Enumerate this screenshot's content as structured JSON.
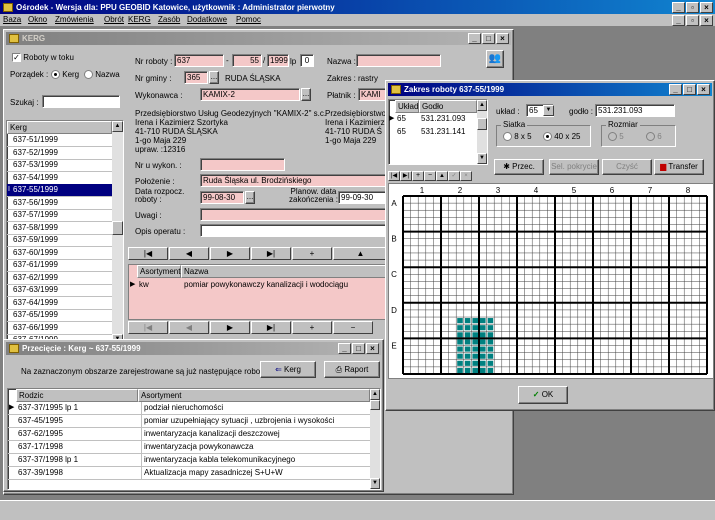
{
  "app": {
    "title": "Ośrodek - Wersja dla: PPU GEOBID Katowice, użytkownik : Administrator pierwotny",
    "menu": [
      "Baza",
      "Okno",
      "Zmówienia",
      "Obrót",
      "KERG",
      "Zasób",
      "Dodatkowe",
      "Pomoc"
    ]
  },
  "kerg": {
    "title": "KERG",
    "roboty_w_toku": "Roboty w toku",
    "porzadek_label": "Porządek :",
    "porzadek_kerg": "Kerg",
    "porzadek_nazwa": "Nazwa",
    "szukaj_label": "Szukaj :",
    "szukaj_value": "",
    "list_header": "Kerg",
    "list": [
      "637-51/1999",
      "637-52/1999",
      "637-53/1999",
      "637-54/1999",
      "637-55/1999",
      "637-56/1999",
      "637-57/1999",
      "637-58/1999",
      "637-59/1999",
      "637-60/1999",
      "637-61/1999",
      "637-62/1999",
      "637-63/1999",
      "637-64/1999",
      "637-65/1999",
      "637-66/1999",
      "637-67/1999"
    ],
    "selected_index": 4,
    "nr_roboty_label": "Nr roboty :",
    "nr1": "637",
    "nr2": "55",
    "nr3": "1999",
    "lp_label": "lp",
    "lp_value": "0",
    "nazwa_label": "Nazwa :",
    "nazwa_value": "",
    "nr_gminy_label": "Nr gminy :",
    "nr_gminy_value": "365",
    "gmina_name": "RUDA ŚLĄSKA",
    "zakres_label": "Zakres :",
    "zakres_value": "rastry",
    "wykonawca_label": "Wykonawca :",
    "wykonawca_value": "KAMIX-2",
    "platnik_label": "Płatnik :",
    "platnik_value": "KAMI",
    "wykonawca_address": [
      "Przedsiębiorstwo Usług Geodezyjnych \"KAMIX-2\" s.c.",
      "Irena i Kazimierz Szortyka",
      "41-710 RUDA ŚLĄSKA",
      "1-go Maja 229",
      "upraw. :12316"
    ],
    "platnik_address": [
      "Przedsiębiorstwo",
      "Irena i Kazimierz",
      "41-710 RUDA Ś",
      "1-go Maja 229"
    ],
    "nr_u_wykon_label": "Nr u wykon. :",
    "polozenie_label": "Położenie :",
    "polozenie_value": "Ruda Śląska ul. Brodzińskiego",
    "data_rozp_label1": "Data rozpocz.",
    "data_rozp_label2": "roboty :",
    "data_rozp_value": "99-08-30",
    "planow_label1": "Planow. data",
    "planow_label2": "zakończenia :",
    "planow_value": "99-09-30",
    "uwagi_label": "Uwagi :",
    "opis_label": "Opis operatu :",
    "asort_headers": [
      "Asortyment",
      "Nazwa"
    ],
    "asort_rows": [
      {
        "code": "kw",
        "name": "pomiar powykonawczy kanalizacji i wodociągu"
      }
    ]
  },
  "zakres": {
    "title": "Zakres roboty 637-55/1999",
    "headers": [
      "Układ",
      "Godło"
    ],
    "rows": [
      {
        "uklad": "65",
        "godlo": "531.231.093"
      },
      {
        "uklad": "65",
        "godlo": "531.231.141"
      }
    ],
    "uklad_label": "układ :",
    "uklad_value": "65",
    "godlo_label": "godło :",
    "godlo_value": "531.231.093",
    "siatka_label": "Siatka",
    "siatka_opt1": "8 x 5",
    "siatka_opt2": "40 x 25",
    "rozmiar_label": "Rozmiar",
    "rozmiar_opt1": "5",
    "rozmiar_opt2": "6",
    "btn_przec": "Przec.",
    "btn_sel": "Sel. pokrycie",
    "btn_czysc": "Czyść",
    "btn_transfer": "Transfer",
    "col_labels": [
      "1",
      "2",
      "3",
      "4",
      "5",
      "6",
      "7",
      "8"
    ],
    "row_labels": [
      "A",
      "B",
      "C",
      "D",
      "E"
    ],
    "ok_label": "OK"
  },
  "przeciecie": {
    "title": "Przecięcie :  Kerg ~ 637-55/1999",
    "info": "Na zaznaczonym obszarze zarejestrowane są już następujące roboty :",
    "btn_kerg": "Kerg",
    "btn_raport": "Raport",
    "headers": [
      "Rodzic",
      "Asortyment"
    ],
    "rows": [
      {
        "rodzic": "637-37/1995 lp 1",
        "asort": "podział nieruchomości"
      },
      {
        "rodzic": "637-45/1995",
        "asort": "pomiar uzupełniający sytuacji , uzbrojenia i wysokości"
      },
      {
        "rodzic": "637-62/1995",
        "asort": "inwentaryzacja kanalizacji deszczowej"
      },
      {
        "rodzic": "637-17/1998",
        "asort": "inwentaryzacja powykonawcza"
      },
      {
        "rodzic": "637-37/1998 lp 1",
        "asort": "inwentaryzacja kabla telekomunikacyjnego"
      },
      {
        "rodzic": "637-39/1998",
        "asort": "Aktualizacja mapy zasadniczej S+U+W"
      }
    ]
  },
  "colors": {
    "titlebar": "#000080",
    "pink": "#f4c8c8",
    "grid_fill": "#008080"
  }
}
